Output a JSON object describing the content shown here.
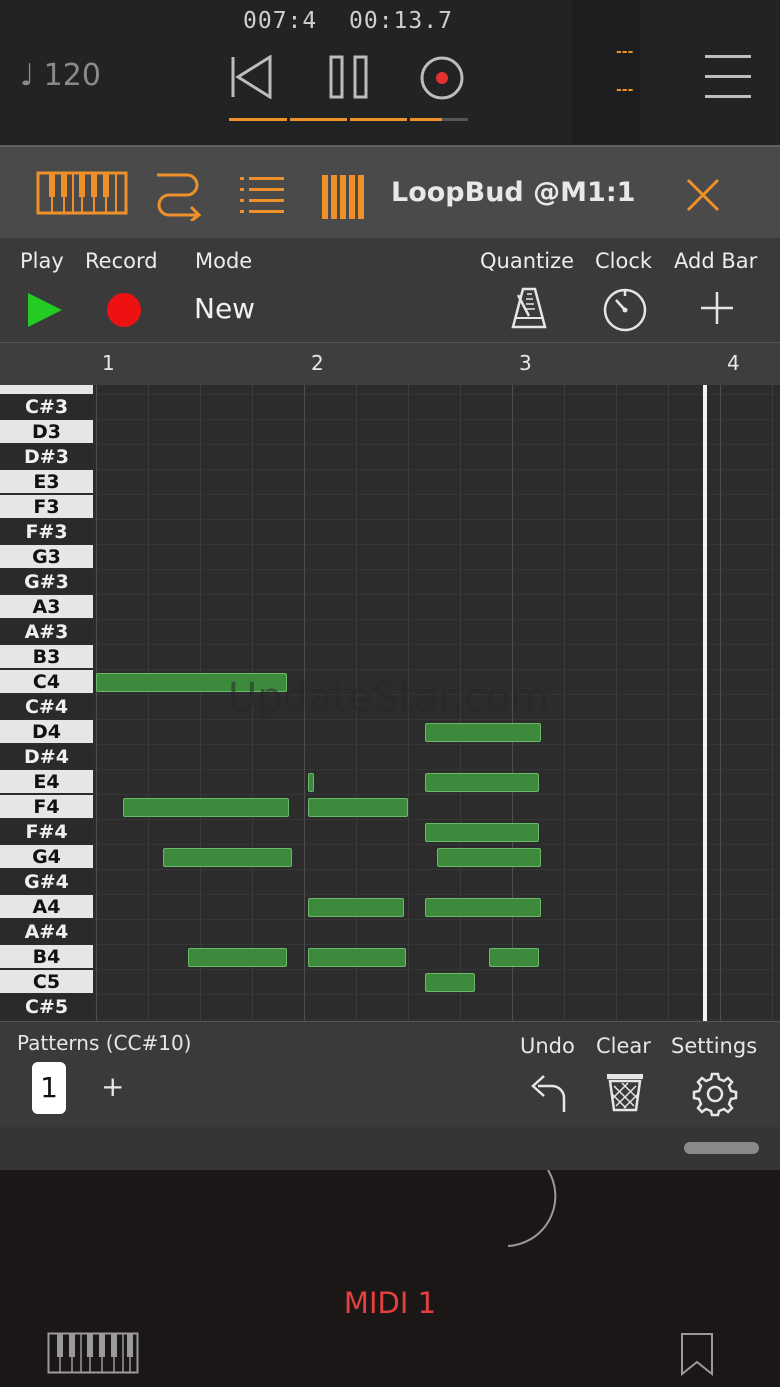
{
  "transport": {
    "bpm": "♩ 120",
    "position": "007:4",
    "time": "00:13.7",
    "level_top": "---",
    "level_bottom": "---",
    "colors": {
      "accent": "#f0902a",
      "text": "#cfcfcf"
    }
  },
  "plugin": {
    "title": "LoopBud @M1:1",
    "tabs": [
      "piano-keys-icon",
      "routing-icon",
      "list-icon",
      "bars-icon"
    ]
  },
  "controls": {
    "play_label": "Play",
    "record_label": "Record",
    "mode_label": "Mode",
    "mode_value": "New",
    "quantize_label": "Quantize",
    "clock_label": "Clock",
    "add_bar_label": "Add Bar"
  },
  "ruler": {
    "bars": [
      "1",
      "2",
      "3",
      "4"
    ]
  },
  "keys": [
    {
      "label": "C#3",
      "black": true
    },
    {
      "label": "D3",
      "black": false
    },
    {
      "label": "D#3",
      "black": true
    },
    {
      "label": "E3",
      "black": false
    },
    {
      "label": "F3",
      "black": false
    },
    {
      "label": "F#3",
      "black": true
    },
    {
      "label": "G3",
      "black": false
    },
    {
      "label": "G#3",
      "black": true
    },
    {
      "label": "A3",
      "black": false
    },
    {
      "label": "A#3",
      "black": true
    },
    {
      "label": "B3",
      "black": false
    },
    {
      "label": "C4",
      "black": false
    },
    {
      "label": "C#4",
      "black": true
    },
    {
      "label": "D4",
      "black": false
    },
    {
      "label": "D#4",
      "black": true
    },
    {
      "label": "E4",
      "black": false
    },
    {
      "label": "F4",
      "black": false
    },
    {
      "label": "F#4",
      "black": true
    },
    {
      "label": "G4",
      "black": false
    },
    {
      "label": "G#4",
      "black": true
    },
    {
      "label": "A4",
      "black": false
    },
    {
      "label": "A#4",
      "black": true
    },
    {
      "label": "B4",
      "black": false
    },
    {
      "label": "C5",
      "black": false
    },
    {
      "label": "C#5",
      "black": true
    }
  ],
  "notes": [
    {
      "pitch": "C4",
      "start": 1.0,
      "length": 0.92
    },
    {
      "pitch": "F4",
      "start": 1.13,
      "length": 0.8
    },
    {
      "pitch": "G4",
      "start": 1.32,
      "length": 0.62
    },
    {
      "pitch": "B4",
      "start": 1.44,
      "length": 0.48
    },
    {
      "pitch": "E4",
      "start": 2.02,
      "length": 0.03
    },
    {
      "pitch": "F4",
      "start": 2.02,
      "length": 0.48
    },
    {
      "pitch": "A4",
      "start": 2.02,
      "length": 0.46
    },
    {
      "pitch": "B4",
      "start": 2.02,
      "length": 0.47
    },
    {
      "pitch": "D4",
      "start": 2.58,
      "length": 0.56
    },
    {
      "pitch": "E4",
      "start": 2.58,
      "length": 0.55
    },
    {
      "pitch": "F#4",
      "start": 2.58,
      "length": 0.55
    },
    {
      "pitch": "G4",
      "start": 2.64,
      "length": 0.5
    },
    {
      "pitch": "A4",
      "start": 2.58,
      "length": 0.56
    },
    {
      "pitch": "B4",
      "start": 2.89,
      "length": 0.24
    },
    {
      "pitch": "C5",
      "start": 2.58,
      "length": 0.24
    }
  ],
  "playhead_bar": 3.93,
  "patterns": {
    "label": "Patterns (CC#10)",
    "items": [
      "1"
    ],
    "add_label": "+"
  },
  "bottom": {
    "undo_label": "Undo",
    "clear_label": "Clear",
    "settings_label": "Settings"
  },
  "host": {
    "midi_label": "MIDI 1"
  },
  "watermark": "UpdateStar.com",
  "colors": {
    "note": "#3d8a3d",
    "play": "#22cc22",
    "record": "#ee1111",
    "accent": "#f0902a"
  }
}
